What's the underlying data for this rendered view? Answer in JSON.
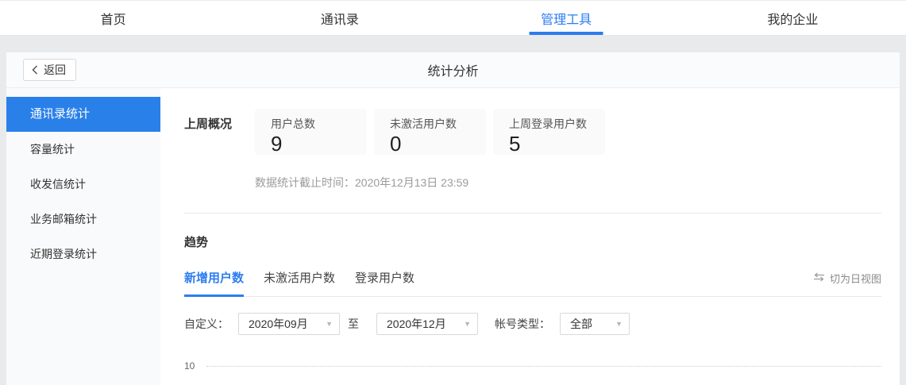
{
  "nav": {
    "items": [
      {
        "label": "首页",
        "active": false
      },
      {
        "label": "通讯录",
        "active": false
      },
      {
        "label": "管理工具",
        "active": true
      },
      {
        "label": "我的企业",
        "active": false
      }
    ]
  },
  "header": {
    "back_label": "返回",
    "title": "统计分析"
  },
  "sidebar": {
    "items": [
      {
        "label": "通讯录统计",
        "active": true
      },
      {
        "label": "容量统计",
        "active": false
      },
      {
        "label": "收发信统计",
        "active": false
      },
      {
        "label": "业务邮箱统计",
        "active": false
      },
      {
        "label": "近期登录统计",
        "active": false
      }
    ]
  },
  "overview": {
    "section_title": "上周概况",
    "cards": [
      {
        "label": "用户总数",
        "value": "9"
      },
      {
        "label": "未激活用户数",
        "value": "0"
      },
      {
        "label": "上周登录用户数",
        "value": "5"
      }
    ],
    "cutoff_note": "数据统计截止时间：2020年12月13日 23:59"
  },
  "trend": {
    "section_title": "趋势",
    "tabs": [
      {
        "label": "新增用户数",
        "active": true
      },
      {
        "label": "未激活用户数",
        "active": false
      },
      {
        "label": "登录用户数",
        "active": false
      }
    ],
    "view_switch_label": "切为日视图",
    "view_switch_icon": "swap-arrows-icon",
    "filters": {
      "custom_label": "自定义：",
      "start_month": "2020年09月",
      "to_label": "至",
      "end_month": "2020年12月",
      "account_type_label": "帐号类型：",
      "account_type_value": "全部"
    },
    "chart": {
      "visible_y_tick": "10",
      "gridline_style": "dotted"
    }
  },
  "colors": {
    "accent": "#2d7cf0",
    "sidebar_active_bg": "#2a80e9",
    "page_bg": "#e9eaeb"
  }
}
